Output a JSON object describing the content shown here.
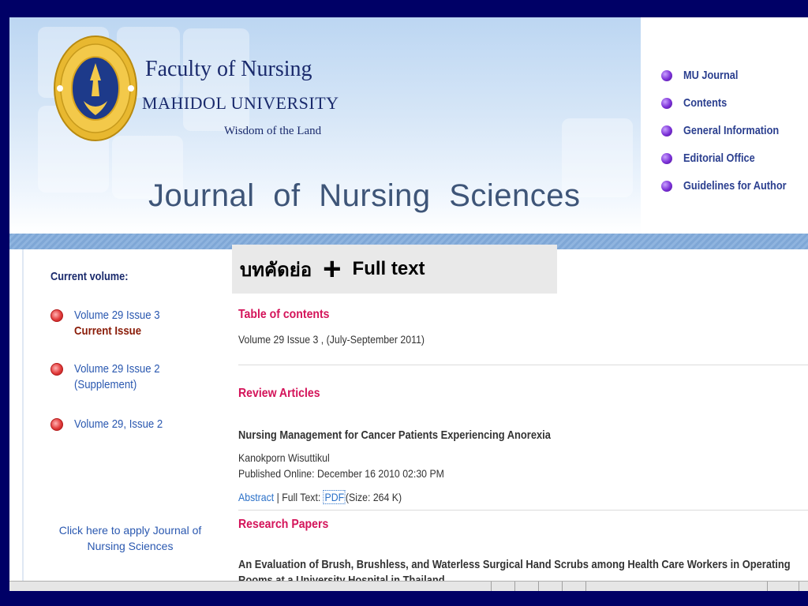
{
  "header": {
    "faculty": "Faculty of Nursing",
    "university": "MAHIDOL UNIVERSITY",
    "motto": "Wisdom of the Land",
    "journal_title": "Journal of Nursing Sciences"
  },
  "topnav": [
    {
      "label": "MU Journal"
    },
    {
      "label": "Contents"
    },
    {
      "label": "General Information"
    },
    {
      "label": "Editorial Office"
    },
    {
      "label": "Guidelines for Author"
    }
  ],
  "overlay_label": {
    "thai": "บทคัดย่อ",
    "plus": "+",
    "full_text": "Full text"
  },
  "sidebar": {
    "title": "Current volume:",
    "volumes": [
      {
        "line1": "Volume 29 Issue 3",
        "line2": "Current Issue"
      },
      {
        "line1": "Volume 29 Issue 2",
        "line2": "(Supplement)"
      },
      {
        "line1": "Volume 29, Issue 2",
        "line2": ""
      }
    ],
    "apply_text": "Click here to apply Journal of Nursing Sciences"
  },
  "main": {
    "toc_heading": "Table of contents",
    "volume_info": "Volume 29 Issue 3 , (July-September 2011)",
    "review_heading": "Review Articles",
    "article1": {
      "title": "Nursing Management for Cancer Patients Experiencing Anorexia",
      "author": "Kanokporn Wisuttikul",
      "published": "Published Online: December 16 2010 02:30 PM",
      "abstract_label": "Abstract",
      "fulltext_label": "| Full Text:",
      "pdf_label": "PDF",
      "size": "(Size: 264 K)"
    },
    "research_heading": "Research Papers",
    "article2": {
      "title": "An Evaluation of Brush, Brushless, and Waterless Surgical Hand Scrubs among Health Care Workers in Operating Rooms at a University Hospital in Thailand"
    }
  },
  "colors": {
    "background": "#000066",
    "heading_pink": "#d4145a",
    "link_blue": "#2a58b0",
    "nav_purple": "#7a2fd6"
  }
}
